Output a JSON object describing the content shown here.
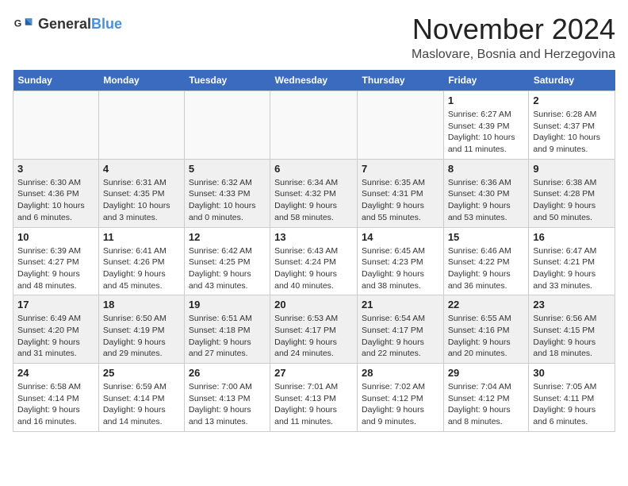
{
  "header": {
    "logo_general": "General",
    "logo_blue": "Blue",
    "month_title": "November 2024",
    "location": "Maslovare, Bosnia and Herzegovina"
  },
  "days_of_week": [
    "Sunday",
    "Monday",
    "Tuesday",
    "Wednesday",
    "Thursday",
    "Friday",
    "Saturday"
  ],
  "weeks": [
    [
      {
        "day": "",
        "info": ""
      },
      {
        "day": "",
        "info": ""
      },
      {
        "day": "",
        "info": ""
      },
      {
        "day": "",
        "info": ""
      },
      {
        "day": "",
        "info": ""
      },
      {
        "day": "1",
        "info": "Sunrise: 6:27 AM\nSunset: 4:39 PM\nDaylight: 10 hours and 11 minutes."
      },
      {
        "day": "2",
        "info": "Sunrise: 6:28 AM\nSunset: 4:37 PM\nDaylight: 10 hours and 9 minutes."
      }
    ],
    [
      {
        "day": "3",
        "info": "Sunrise: 6:30 AM\nSunset: 4:36 PM\nDaylight: 10 hours and 6 minutes."
      },
      {
        "day": "4",
        "info": "Sunrise: 6:31 AM\nSunset: 4:35 PM\nDaylight: 10 hours and 3 minutes."
      },
      {
        "day": "5",
        "info": "Sunrise: 6:32 AM\nSunset: 4:33 PM\nDaylight: 10 hours and 0 minutes."
      },
      {
        "day": "6",
        "info": "Sunrise: 6:34 AM\nSunset: 4:32 PM\nDaylight: 9 hours and 58 minutes."
      },
      {
        "day": "7",
        "info": "Sunrise: 6:35 AM\nSunset: 4:31 PM\nDaylight: 9 hours and 55 minutes."
      },
      {
        "day": "8",
        "info": "Sunrise: 6:36 AM\nSunset: 4:30 PM\nDaylight: 9 hours and 53 minutes."
      },
      {
        "day": "9",
        "info": "Sunrise: 6:38 AM\nSunset: 4:28 PM\nDaylight: 9 hours and 50 minutes."
      }
    ],
    [
      {
        "day": "10",
        "info": "Sunrise: 6:39 AM\nSunset: 4:27 PM\nDaylight: 9 hours and 48 minutes."
      },
      {
        "day": "11",
        "info": "Sunrise: 6:41 AM\nSunset: 4:26 PM\nDaylight: 9 hours and 45 minutes."
      },
      {
        "day": "12",
        "info": "Sunrise: 6:42 AM\nSunset: 4:25 PM\nDaylight: 9 hours and 43 minutes."
      },
      {
        "day": "13",
        "info": "Sunrise: 6:43 AM\nSunset: 4:24 PM\nDaylight: 9 hours and 40 minutes."
      },
      {
        "day": "14",
        "info": "Sunrise: 6:45 AM\nSunset: 4:23 PM\nDaylight: 9 hours and 38 minutes."
      },
      {
        "day": "15",
        "info": "Sunrise: 6:46 AM\nSunset: 4:22 PM\nDaylight: 9 hours and 36 minutes."
      },
      {
        "day": "16",
        "info": "Sunrise: 6:47 AM\nSunset: 4:21 PM\nDaylight: 9 hours and 33 minutes."
      }
    ],
    [
      {
        "day": "17",
        "info": "Sunrise: 6:49 AM\nSunset: 4:20 PM\nDaylight: 9 hours and 31 minutes."
      },
      {
        "day": "18",
        "info": "Sunrise: 6:50 AM\nSunset: 4:19 PM\nDaylight: 9 hours and 29 minutes."
      },
      {
        "day": "19",
        "info": "Sunrise: 6:51 AM\nSunset: 4:18 PM\nDaylight: 9 hours and 27 minutes."
      },
      {
        "day": "20",
        "info": "Sunrise: 6:53 AM\nSunset: 4:17 PM\nDaylight: 9 hours and 24 minutes."
      },
      {
        "day": "21",
        "info": "Sunrise: 6:54 AM\nSunset: 4:17 PM\nDaylight: 9 hours and 22 minutes."
      },
      {
        "day": "22",
        "info": "Sunrise: 6:55 AM\nSunset: 4:16 PM\nDaylight: 9 hours and 20 minutes."
      },
      {
        "day": "23",
        "info": "Sunrise: 6:56 AM\nSunset: 4:15 PM\nDaylight: 9 hours and 18 minutes."
      }
    ],
    [
      {
        "day": "24",
        "info": "Sunrise: 6:58 AM\nSunset: 4:14 PM\nDaylight: 9 hours and 16 minutes."
      },
      {
        "day": "25",
        "info": "Sunrise: 6:59 AM\nSunset: 4:14 PM\nDaylight: 9 hours and 14 minutes."
      },
      {
        "day": "26",
        "info": "Sunrise: 7:00 AM\nSunset: 4:13 PM\nDaylight: 9 hours and 13 minutes."
      },
      {
        "day": "27",
        "info": "Sunrise: 7:01 AM\nSunset: 4:13 PM\nDaylight: 9 hours and 11 minutes."
      },
      {
        "day": "28",
        "info": "Sunrise: 7:02 AM\nSunset: 4:12 PM\nDaylight: 9 hours and 9 minutes."
      },
      {
        "day": "29",
        "info": "Sunrise: 7:04 AM\nSunset: 4:12 PM\nDaylight: 9 hours and 8 minutes."
      },
      {
        "day": "30",
        "info": "Sunrise: 7:05 AM\nSunset: 4:11 PM\nDaylight: 9 hours and 6 minutes."
      }
    ]
  ]
}
